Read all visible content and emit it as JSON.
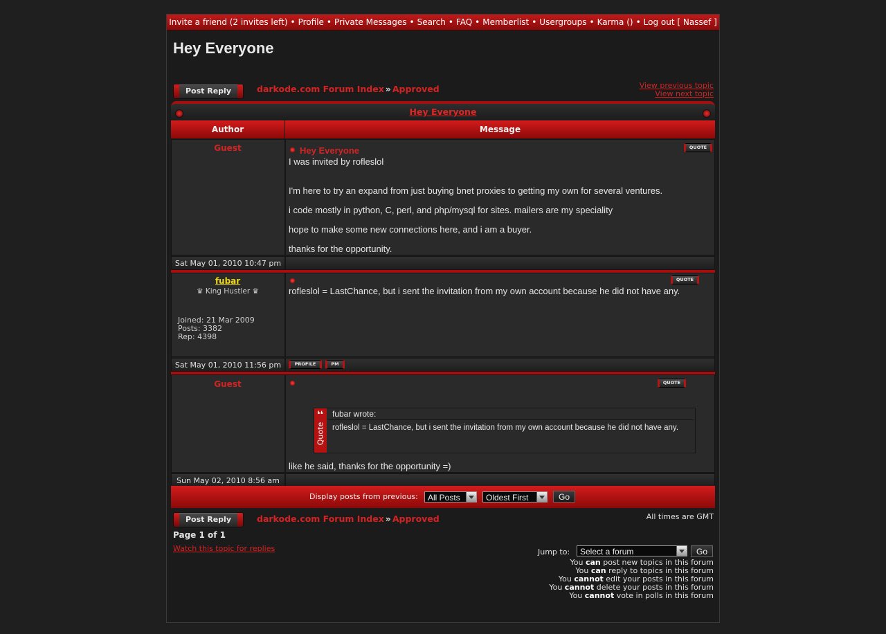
{
  "nav": {
    "items": [
      "Invite a friend (2 invites left)",
      "Profile",
      "Private Messages",
      "Search",
      "FAQ",
      "Memberlist",
      "Usergroups",
      "Karma ()",
      "Log out [ Nassef ]"
    ],
    "separator": "•"
  },
  "page_title": "Hey Everyone",
  "buttons": {
    "post_reply": "Post Reply",
    "go": "Go"
  },
  "breadcrumb": {
    "index": "darkode.com Forum Index",
    "arrow": "»",
    "forum": "Approved"
  },
  "topic_nav": {
    "prev": "View previous topic",
    "next": "View next topic"
  },
  "topic_title": "Hey Everyone",
  "columns": {
    "author": "Author",
    "message": "Message"
  },
  "posts": [
    {
      "author": "Guest",
      "subject": "Hey Everyone",
      "lines": [
        "I was invited by rofleslol",
        "",
        "I'm here to try an expand from just buying bnet proxies to getting my own for several ventures.",
        "i code mostly in python, C, perl, and php/mysql for sites. mailers are my speciality",
        "hope to make some new connections here, and i am a buyer.",
        "thanks for the opportunity."
      ],
      "date": "Sat May 01, 2010 10:47 pm",
      "quote_label": "QUOTE"
    },
    {
      "author": "fubar",
      "rank": "♛ King Hustler ♛",
      "joined": "Joined: 21 Mar 2009",
      "posts": "Posts: 3382",
      "rep": "Rep: 4398",
      "text": "rofleslol = LastChance, but i sent the invitation from my own account because he did not have any.",
      "date": "Sat May 01, 2010 11:56 pm",
      "quote_label": "QUOTE",
      "profile_label": "PROFILE",
      "pm_label": "PM"
    },
    {
      "author": "Guest",
      "quote": {
        "quote_marks": "❛❛",
        "side_label": "Quote",
        "header": "fubar wrote:",
        "body": "rofleslol = LastChance, but i sent the invitation from my own account because he did not have any."
      },
      "text": "like he said, thanks for the opportunity =)",
      "date": "Sun May 02, 2010 8:56 am",
      "quote_label": "QUOTE"
    }
  ],
  "display_bar": {
    "label": "Display posts from previous:",
    "range_selected": "All Posts",
    "order_selected": "Oldest First"
  },
  "timezone": "All times are GMT",
  "pagination": "Page 1 of 1",
  "watch_link": "Watch this topic for replies",
  "jump": {
    "label": "Jump to:",
    "selected": "Select a forum"
  },
  "permissions": [
    {
      "pre": "You ",
      "bold": "can",
      "post": " post new topics in this forum"
    },
    {
      "pre": "You ",
      "bold": "can",
      "post": " reply to topics in this forum"
    },
    {
      "pre": "You ",
      "bold": "cannot",
      "post": " edit your posts in this forum"
    },
    {
      "pre": "You ",
      "bold": "cannot",
      "post": " delete your posts in this forum"
    },
    {
      "pre": "You ",
      "bold": "cannot",
      "post": " vote in polls in this forum"
    }
  ],
  "colors": {
    "accent": "#c11a1a",
    "username": "#ecd71a",
    "link": "#d42323"
  }
}
